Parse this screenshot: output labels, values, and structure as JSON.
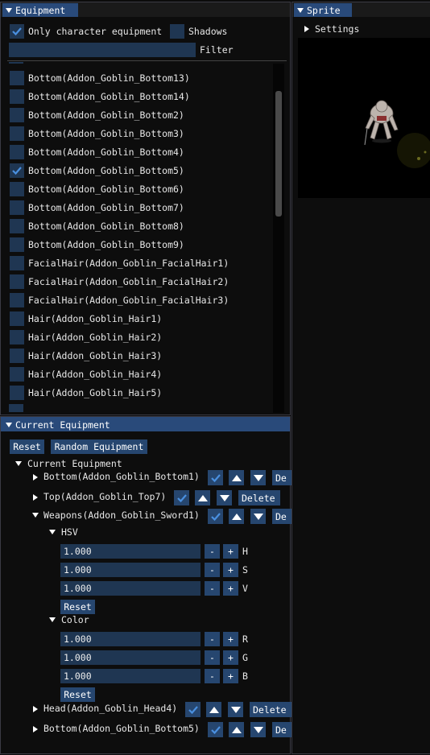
{
  "equipment_window": {
    "title": "Equipment",
    "only_char_label": "Only character equipment",
    "shadows_label": "Shadows",
    "filter_label": "Filter",
    "filter_value": "",
    "items": [
      {
        "label": "Bottom(Addon_Goblin_Bottom13)",
        "checked": false
      },
      {
        "label": "Bottom(Addon_Goblin_Bottom14)",
        "checked": false
      },
      {
        "label": "Bottom(Addon_Goblin_Bottom2)",
        "checked": false
      },
      {
        "label": "Bottom(Addon_Goblin_Bottom3)",
        "checked": false
      },
      {
        "label": "Bottom(Addon_Goblin_Bottom4)",
        "checked": false
      },
      {
        "label": "Bottom(Addon_Goblin_Bottom5)",
        "checked": true
      },
      {
        "label": "Bottom(Addon_Goblin_Bottom6)",
        "checked": false
      },
      {
        "label": "Bottom(Addon_Goblin_Bottom7)",
        "checked": false
      },
      {
        "label": "Bottom(Addon_Goblin_Bottom8)",
        "checked": false
      },
      {
        "label": "Bottom(Addon_Goblin_Bottom9)",
        "checked": false
      },
      {
        "label": "FacialHair(Addon_Goblin_FacialHair1)",
        "checked": false
      },
      {
        "label": "FacialHair(Addon_Goblin_FacialHair2)",
        "checked": false
      },
      {
        "label": "FacialHair(Addon_Goblin_FacialHair3)",
        "checked": false
      },
      {
        "label": "Hair(Addon_Goblin_Hair1)",
        "checked": false
      },
      {
        "label": "Hair(Addon_Goblin_Hair2)",
        "checked": false
      },
      {
        "label": "Hair(Addon_Goblin_Hair3)",
        "checked": false
      },
      {
        "label": "Hair(Addon_Goblin_Hair4)",
        "checked": false
      },
      {
        "label": "Hair(Addon_Goblin_Hair5)",
        "checked": false
      }
    ]
  },
  "sprite_window": {
    "title": "Sprite",
    "settings_label": "Settings"
  },
  "current_window": {
    "title": "Current Equipment",
    "reset_label": "Reset",
    "random_label": "Random Equipment",
    "tree_label": "Current Equipment",
    "entries": [
      {
        "label": "Bottom(Addon_Goblin_Bottom1)",
        "delete": "De"
      },
      {
        "label": "Top(Addon_Goblin_Top7)",
        "delete": "Delete"
      },
      {
        "label": "Weapons(Addon_Goblin_Sword1)",
        "delete": "De"
      },
      {
        "label": "Head(Addon_Goblin_Head4)",
        "delete": "Delete"
      },
      {
        "label": "Bottom(Addon_Goblin_Bottom5)",
        "delete": "De"
      }
    ],
    "hsv": {
      "label": "HSV",
      "rows": [
        {
          "value": "1.000",
          "minus": "-",
          "plus": "+",
          "name": "H"
        },
        {
          "value": "1.000",
          "minus": "-",
          "plus": "+",
          "name": "S"
        },
        {
          "value": "1.000",
          "minus": "-",
          "plus": "+",
          "name": "V"
        }
      ],
      "reset_label": "Reset"
    },
    "color": {
      "label": "Color",
      "rows": [
        {
          "value": "1.000",
          "minus": "-",
          "plus": "+",
          "name": "R"
        },
        {
          "value": "1.000",
          "minus": "-",
          "plus": "+",
          "name": "G"
        },
        {
          "value": "1.000",
          "minus": "-",
          "plus": "+",
          "name": "B"
        }
      ],
      "reset_label": "Reset"
    }
  },
  "icons": {
    "check": "check-icon",
    "collapse": "triangle-down-icon",
    "expand": "triangle-right-icon",
    "move_up": "arrow-up-icon",
    "move_down": "arrow-down-icon"
  },
  "colors": {
    "accent": "#294a7a",
    "button": "#26466f",
    "frame": "#1f3652",
    "check": "#4a90e0"
  }
}
